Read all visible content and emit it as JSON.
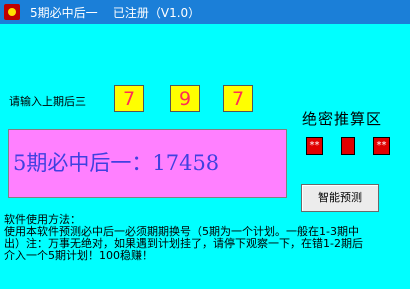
{
  "window": {
    "title": "5期必中后一    已注册（V1.0）"
  },
  "input": {
    "label": "请输入上期后三",
    "digits": [
      "7",
      "9",
      "7"
    ]
  },
  "secret": {
    "title": "绝密推算区",
    "boxes": [
      "**",
      "",
      "**"
    ]
  },
  "result": {
    "text": "5期必中后一：17458"
  },
  "buttons": {
    "predict": "智能预测"
  },
  "instructions": {
    "heading": "软件使用方法：",
    "lines": [
      "使用本软件预测必中后一必须期期换号（5期为一个计划。一般在1-3期中",
      "出）注：万事无绝对，如果遇到计划挂了，请停下观察一下，在错1-2期后",
      "介入一个5期计划！100稳赚！"
    ]
  },
  "colors": {
    "background": "#00ffff",
    "titlebar": "#1b7fd8",
    "digit_box": "#ffff00",
    "digit_text": "#ff2d55",
    "result_box": "#ff80ff",
    "result_text": "#4040e0",
    "secret_box": "#e00000"
  }
}
